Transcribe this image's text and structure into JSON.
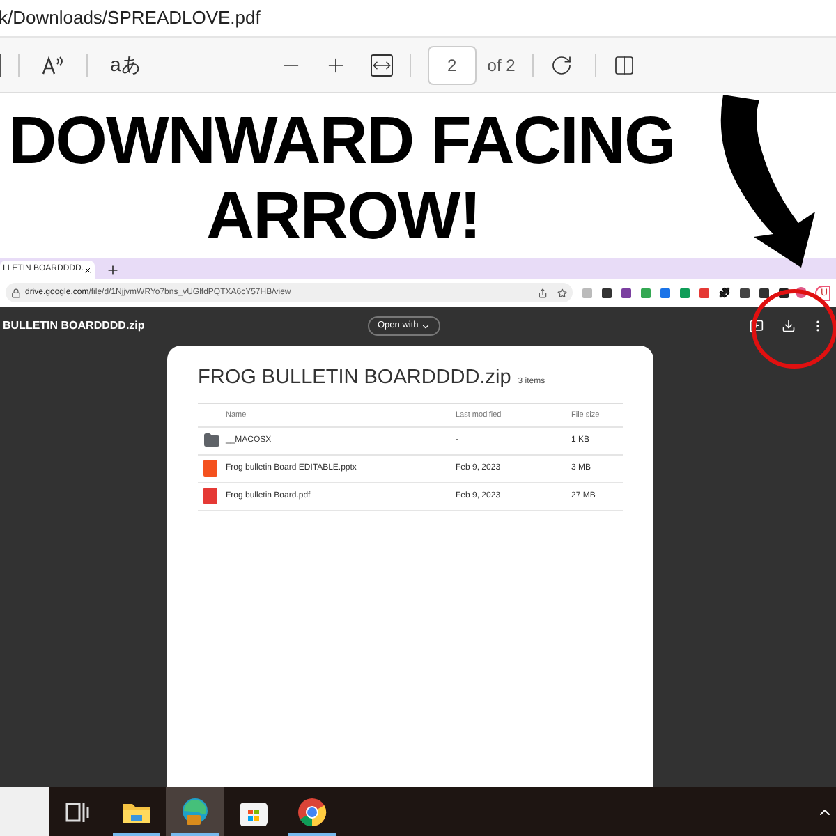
{
  "address_bar": {
    "path": "k/Downloads/SPREADLOVE.pdf"
  },
  "pdf_toolbar": {
    "translate_label": "aあ",
    "page_value": "2",
    "page_total": "of 2"
  },
  "annotation": {
    "lines": [
      "DOWNWARD FACING",
      "ARROW!"
    ]
  },
  "browser": {
    "tab_title": "LLETIN BOARDDDD.",
    "url_host": "drive.google.com",
    "url_path": "/file/d/1NjjvmWRYo7bns_vUGlfdPQTXA6cY57HB/view",
    "profile_button": "U"
  },
  "drive": {
    "file_name": "BULLETIN BOARDDDD.zip",
    "open_with": "Open with",
    "card": {
      "title": "FROG BULLETIN BOARDDDD.zip",
      "count": "3 items",
      "columns": [
        "Name",
        "Last modified",
        "File size"
      ],
      "rows": [
        {
          "kind": "folder",
          "name": "__MACOSX",
          "modified": "-",
          "size": "1 KB"
        },
        {
          "kind": "pptx",
          "name": "Frog bulletin Board EDITABLE.pptx",
          "modified": "Feb 9, 2023",
          "size": "3 MB"
        },
        {
          "kind": "pdf",
          "name": "Frog bulletin Board.pdf",
          "modified": "Feb 9, 2023",
          "size": "27 MB"
        }
      ]
    }
  },
  "taskbar": {
    "items": [
      {
        "kind": "taskview",
        "open": false,
        "selected": false
      },
      {
        "kind": "explorer",
        "open": true,
        "selected": false
      },
      {
        "kind": "edge",
        "open": true,
        "selected": true
      },
      {
        "kind": "store",
        "open": false,
        "selected": false
      },
      {
        "kind": "chrome",
        "open": true,
        "selected": false
      }
    ]
  }
}
